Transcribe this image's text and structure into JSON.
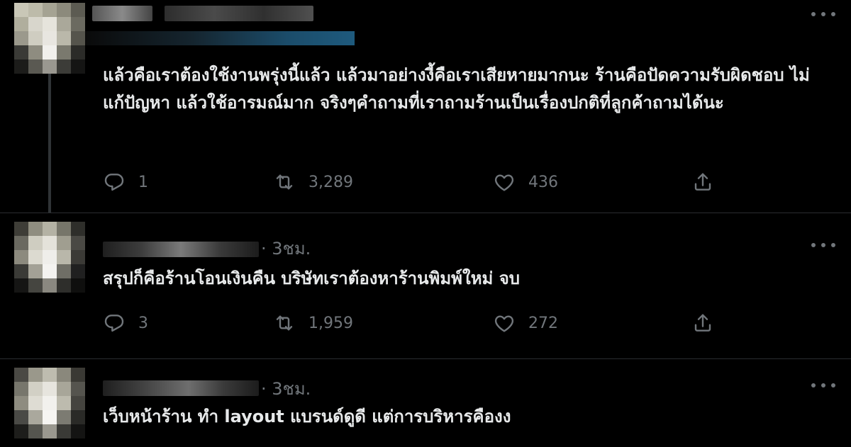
{
  "tweets": [
    {
      "time": "",
      "text": "แล้วคือเราต้องใช้งานพรุ่งนี้แล้ว แล้วมาอย่างงี้คือเราเสียหายมากนะ ร้านคือปัดความรับผิดชอบ ไม่แก้ปัญหา แล้วใช้อารมณ์มาก จริงๆคำถามที่เราถามร้านเป็นเรื่องปกติที่ลูกค้าถามได้นะ",
      "replies": "1",
      "retweets": "3,289",
      "likes": "436"
    },
    {
      "time": "· 3ชม.",
      "text": "สรุปก็คือร้านโอนเงินคืน บริษัทเราต้องหาร้านพิมพ์ใหม่ จบ",
      "replies": "3",
      "retweets": "1,959",
      "likes": "272"
    },
    {
      "time": "· 3ชม.",
      "text": "เว็บหน้าร้าน ทำ layout แบรนด์ดูดี แต่การบริหารคืองง"
    }
  ],
  "icons": {
    "reply": "reply-icon",
    "retweet": "retweet-icon",
    "like": "heart-icon",
    "share": "share-icon",
    "more": "more-icon"
  },
  "colors": {
    "background": "#000000",
    "text": "#e7e9ea",
    "muted": "#71767b",
    "divider": "#2f3336"
  }
}
